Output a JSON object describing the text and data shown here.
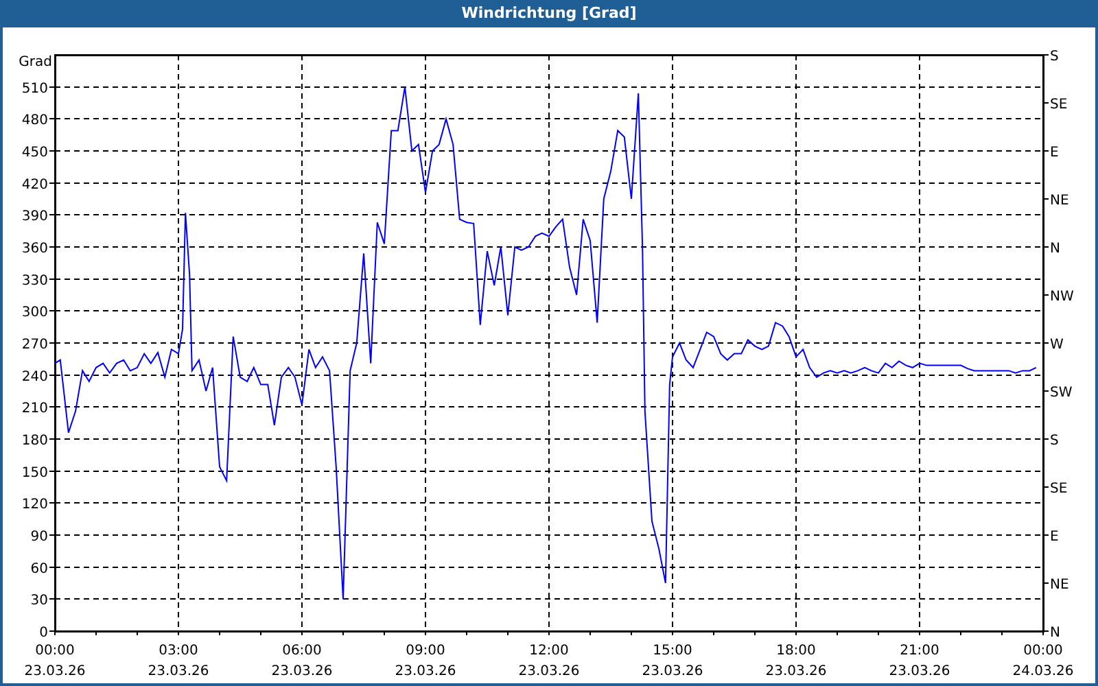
{
  "window": {
    "title": "Windrichtung [Grad]"
  },
  "chart": {
    "compass_ticks": [
      "S",
      "SE",
      "E",
      "NE",
      "N",
      "NW",
      "W",
      "SW",
      "S",
      "SE",
      "E",
      "NE",
      "N"
    ],
    "tick_dates": [
      "23.03.26",
      "23.03.26",
      "23.03.26",
      "23.03.26",
      "23.03.26",
      "23.03.26",
      "23.03.26",
      "23.03.26",
      "24.03.26"
    ],
    "chart_data": {
      "type": "line",
      "grid": true,
      "ylabel": "Grad",
      "xlim": [
        0,
        24
      ],
      "ylim": [
        0,
        540
      ],
      "yticks": [
        0,
        30,
        60,
        90,
        120,
        150,
        180,
        210,
        240,
        270,
        300,
        330,
        360,
        390,
        420,
        450,
        480,
        510
      ],
      "xticks": [
        {
          "value": 0,
          "label": "00:00"
        },
        {
          "value": 3,
          "label": "03:00"
        },
        {
          "value": 6,
          "label": "06:00"
        },
        {
          "value": 9,
          "label": "09:00"
        },
        {
          "value": 12,
          "label": "12:00"
        },
        {
          "value": 15,
          "label": "15:00"
        },
        {
          "value": 18,
          "label": "18:00"
        },
        {
          "value": 21,
          "label": "21:00"
        },
        {
          "value": 24,
          "label": "00:00"
        }
      ],
      "x": [
        0,
        0.13,
        0.33,
        0.5,
        0.67,
        0.83,
        1,
        1.17,
        1.33,
        1.5,
        1.67,
        1.83,
        2,
        2.17,
        2.33,
        2.5,
        2.67,
        2.83,
        3,
        3.1,
        3.17,
        3.27,
        3.33,
        3.5,
        3.67,
        3.83,
        4,
        4.17,
        4.33,
        4.5,
        4.67,
        4.83,
        5,
        5.17,
        5.33,
        5.5,
        5.67,
        5.83,
        6,
        6.17,
        6.33,
        6.5,
        6.67,
        6.83,
        7,
        7.17,
        7.33,
        7.5,
        7.67,
        7.83,
        8,
        8.17,
        8.33,
        8.5,
        8.67,
        8.83,
        9,
        9.17,
        9.33,
        9.5,
        9.67,
        9.83,
        10,
        10.17,
        10.33,
        10.5,
        10.67,
        10.83,
        11,
        11.17,
        11.33,
        11.5,
        11.67,
        11.83,
        12,
        12.17,
        12.33,
        12.5,
        12.67,
        12.83,
        13,
        13.17,
        13.33,
        13.5,
        13.67,
        13.83,
        14,
        14.17,
        14.27,
        14.33,
        14.5,
        14.67,
        14.83,
        14.93,
        15,
        15.17,
        15.33,
        15.5,
        15.67,
        15.83,
        16,
        16.17,
        16.33,
        16.5,
        16.67,
        16.83,
        17,
        17.17,
        17.33,
        17.5,
        17.67,
        17.83,
        18,
        18.17,
        18.33,
        18.5,
        18.67,
        18.83,
        19,
        19.17,
        19.33,
        19.5,
        19.67,
        19.83,
        20,
        20.17,
        20.33,
        20.5,
        20.67,
        20.83,
        21,
        21.17,
        21.33,
        21.5,
        21.67,
        21.83,
        22,
        22.17,
        22.33,
        22.5,
        22.67,
        22.83,
        23,
        23.17,
        23.33,
        23.5,
        23.67,
        23.83
      ],
      "series": [
        {
          "color": "#0000ff",
          "values": [
            251,
            254,
            186,
            206,
            244,
            234,
            247,
            251,
            242,
            251,
            254,
            244,
            247,
            260,
            251,
            261,
            238,
            264,
            260,
            283,
            392,
            334,
            244,
            254,
            225,
            247,
            154,
            141,
            276,
            238,
            234,
            247,
            231,
            231,
            193,
            238,
            247,
            238,
            212,
            264,
            247,
            257,
            244,
            154,
            30,
            244,
            270,
            354,
            251,
            383,
            363,
            469,
            469,
            510,
            450,
            456,
            411,
            450,
            456,
            480,
            456,
            386,
            383,
            382,
            287,
            356,
            324,
            360,
            296,
            360,
            357,
            360,
            370,
            373,
            370,
            379,
            386,
            341,
            315,
            386,
            366,
            289,
            405,
            431,
            469,
            463,
            405,
            504,
            360,
            206,
            103,
            77,
            45,
            231,
            257,
            270,
            254,
            247,
            264,
            280,
            276,
            260,
            254,
            260,
            260,
            273,
            267,
            264,
            267,
            289,
            286,
            276,
            257,
            264,
            247,
            238,
            242,
            244,
            242,
            244,
            242,
            244,
            247,
            244,
            242,
            251,
            247,
            253,
            249,
            247,
            251,
            249,
            249,
            249,
            249,
            249,
            249,
            246,
            244,
            244,
            244,
            244,
            244,
            244,
            242,
            244,
            244,
            247
          ]
        }
      ]
    }
  }
}
